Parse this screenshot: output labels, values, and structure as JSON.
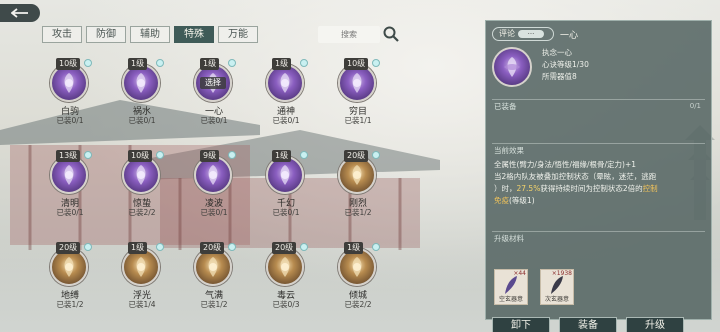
{
  "tabs": [
    {
      "label": "攻击"
    },
    {
      "label": "防御"
    },
    {
      "label": "辅助"
    },
    {
      "label": "特殊"
    },
    {
      "label": "万能"
    }
  ],
  "active_tab": 3,
  "search": {
    "placeholder": "搜索"
  },
  "items": [
    {
      "name": "白驹",
      "level": "10级",
      "equipped": "已装0/1",
      "style": "purple"
    },
    {
      "name": "祸水",
      "level": "1级",
      "equipped": "已装0/1",
      "style": "purple"
    },
    {
      "name": "一心",
      "level": "1级",
      "equipped": "已装0/1",
      "style": "purple",
      "center_label": "选择"
    },
    {
      "name": "通神",
      "level": "1级",
      "equipped": "已装0/1",
      "style": "purple"
    },
    {
      "name": "穷目",
      "level": "10级",
      "equipped": "已装1/1",
      "style": "purple"
    },
    {
      "name": "清明",
      "level": "13级",
      "equipped": "已装0/1",
      "style": "purple"
    },
    {
      "name": "惊蛰",
      "level": "10级",
      "equipped": "已装2/2",
      "style": "purple"
    },
    {
      "name": "凌波",
      "level": "9级",
      "equipped": "已装0/1",
      "style": "purple"
    },
    {
      "name": "千幻",
      "level": "1级",
      "equipped": "已装0/1",
      "style": "purple"
    },
    {
      "name": "刚烈",
      "level": "20级",
      "equipped": "已装1/2",
      "style": "gold"
    },
    {
      "name": "地缚",
      "level": "20级",
      "equipped": "已装1/2",
      "style": "gold"
    },
    {
      "name": "浮光",
      "level": "1级",
      "equipped": "已装1/4",
      "style": "gold"
    },
    {
      "name": "气满",
      "level": "20级",
      "equipped": "已装1/2",
      "style": "gold"
    },
    {
      "name": "毒云",
      "level": "20级",
      "equipped": "已装0/3",
      "style": "gold"
    },
    {
      "name": "倾城",
      "level": "1级",
      "equipped": "已装2/2",
      "style": "gold"
    }
  ],
  "panel": {
    "comment_label": "评论",
    "dots": "···",
    "title": "一心",
    "lines": [
      "执念一心",
      "心诀等级1/30",
      "所需器值8"
    ],
    "equipped_label": "已装备",
    "equipped_count": "0/1",
    "effect_label": "当前效果",
    "effect_line1": "全属性(臂力/身法/悟性/福缘/根骨/定力)+1",
    "effect_line2": "当2格内队友被叠加控制状态（晕眩，迷茫，逃跑",
    "effect_line3a": "）时，",
    "effect_line3b": "27.5%",
    "effect_line3c": "获得持续时间为控制状态2倍的",
    "effect_line3d": "控制",
    "effect_line4": "免疫",
    "effect_line4b": "(等级1)",
    "upgrade_label": "升级材料",
    "materials": [
      {
        "qty": "×44",
        "name": "空玄器意"
      },
      {
        "qty": "×1938",
        "name": "次玄器意"
      }
    ],
    "buttons": {
      "unload": "卸下",
      "equip": "装备",
      "upgrade": "升级"
    }
  },
  "colors": {
    "panel_bg": "#576764",
    "accent_gold": "#f4d36b",
    "active_tab": "#3f5b58"
  }
}
